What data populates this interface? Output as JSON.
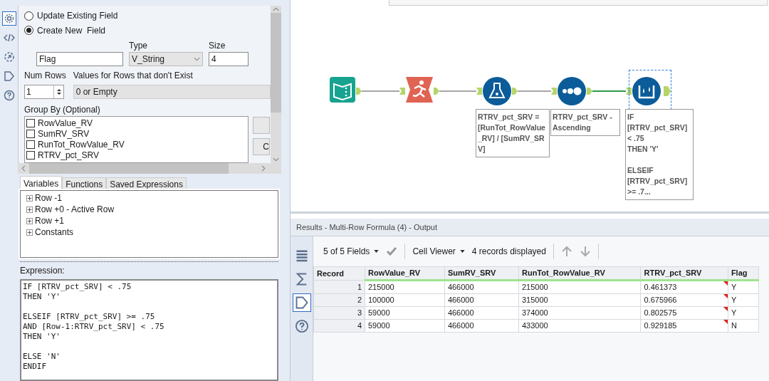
{
  "side_icons": [
    {
      "kind": "gear",
      "selected": true
    },
    {
      "kind": "code",
      "selected": false
    },
    {
      "kind": "export",
      "selected": false
    },
    {
      "kind": "tag",
      "selected": false
    },
    {
      "kind": "help",
      "selected": false
    }
  ],
  "radios": [
    {
      "label": "Update Existing Field",
      "selected": false
    },
    {
      "label": "Create New  Field",
      "selected": true
    }
  ],
  "new_field": {
    "name": "Flag",
    "type_label": "Type",
    "type_value": "V_String",
    "size_label": "Size",
    "size_value": "4"
  },
  "num_rows": {
    "label": "Num Rows",
    "value": "1"
  },
  "missing_rows": {
    "label": "Values for Rows that don't Exist",
    "value": "0 or Empty"
  },
  "group_by": {
    "label": "Group By (Optional)",
    "fields": [
      {
        "label": "RowValue_RV",
        "checked": false
      },
      {
        "label": "SumRV_SRV",
        "checked": false
      },
      {
        "label": "RunTot_RowValue_RV",
        "checked": false
      },
      {
        "label": "RTRV_pct_SRV",
        "checked": false
      }
    ],
    "button_2": "C"
  },
  "tabs": [
    {
      "label": "Variables",
      "selected": true
    },
    {
      "label": "Functions",
      "selected": false
    },
    {
      "label": "Saved Expressions",
      "selected": false
    }
  ],
  "variables": [
    {
      "label": "Row -1",
      "expanded": false
    },
    {
      "label": "Row +0 - Active Row",
      "expanded": false
    },
    {
      "label": "Row +1",
      "expanded": false
    },
    {
      "label": "Constants",
      "expanded": false
    }
  ],
  "expression": {
    "label": "Expression:",
    "text": "IF [RTRV_pct_SRV] < .75\nTHEN 'Y'\n\nELSEIF [RTRV_pct_SRV] >= .75\nAND [Row-1:RTRV_pct_SRV] < .75\nTHEN 'Y'\n\nELSE 'N'\nENDIF"
  },
  "workflow": {
    "nodes": [
      {
        "kind": "input",
        "selected": false
      },
      {
        "kind": "select",
        "selected": false
      },
      {
        "kind": "formula",
        "selected": false,
        "annotation": "RTRV_pct_SRV = [RunTot_RowValue_RV] / [SumRV_SRV]"
      },
      {
        "kind": "sort",
        "selected": false,
        "annotation": "RTRV_pct_SRV - Ascending"
      },
      {
        "kind": "multirow",
        "selected": true,
        "annotation": "IF [RTRV_pct_SRV] < .75\nTHEN 'Y'\n\nELSEIF [RTRV_pct_SRV] >= .7..."
      }
    ]
  },
  "results": {
    "title": "Results - Multi-Row Formula (4) - Output",
    "fields": "5 of 5 Fields",
    "viewer": "Cell Viewer",
    "count": "4 records displayed",
    "side_icons": [
      {
        "kind": "list",
        "selected": false
      },
      {
        "kind": "sigma",
        "selected": false
      },
      {
        "kind": "tag",
        "selected": true
      },
      {
        "kind": "help",
        "selected": false
      }
    ],
    "columns": [
      {
        "label": "Record",
        "flagged": false
      },
      {
        "label": "RowValue_RV",
        "flagged": false
      },
      {
        "label": "SumRV_SRV",
        "flagged": false
      },
      {
        "label": "RunTot_RowValue_RV",
        "flagged": false
      },
      {
        "label": "RTRV_pct_SRV",
        "flagged": true
      },
      {
        "label": "Flag",
        "flagged": false
      }
    ],
    "rows": [
      [
        "1",
        "215000",
        "466000",
        "215000",
        "0.461373",
        "Y"
      ],
      [
        "2",
        "100000",
        "466000",
        "315000",
        "0.675966",
        "Y"
      ],
      [
        "3",
        "59000",
        "466000",
        "374000",
        "0.802575",
        "Y"
      ],
      [
        "4",
        "59000",
        "466000",
        "433000",
        "0.929185",
        "N"
      ]
    ]
  }
}
